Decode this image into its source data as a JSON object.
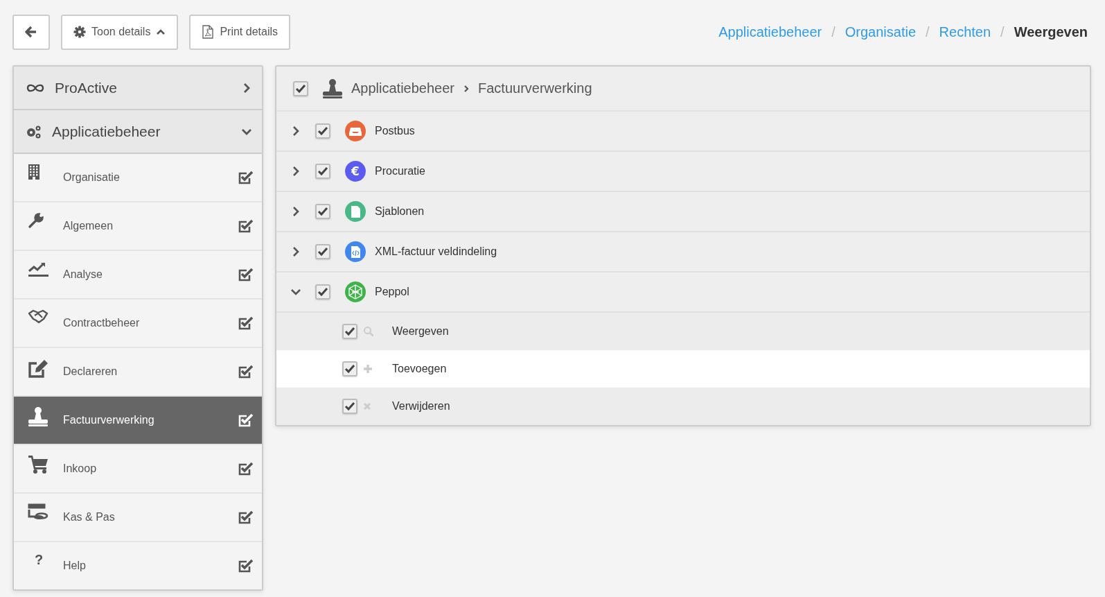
{
  "toolbar": {
    "details_button": {
      "label": "Toon details",
      "expanded": true
    },
    "print_button": {
      "label": "Print details"
    }
  },
  "breadcrumb": [
    {
      "label": "Applicatiebeheer",
      "current": false
    },
    {
      "separator": "/",
      "label": "Organisatie",
      "current": false
    },
    {
      "separator": "/",
      "label": "Rechten",
      "current": false
    },
    {
      "separator": "/",
      "label": "Weergeven",
      "current": true
    }
  ],
  "sidebar": {
    "sections": [
      {
        "label": "ProActive",
        "kind": "infinity",
        "expanded": false
      },
      {
        "label": "Applicatiebeheer",
        "kind": "gears",
        "expanded": true
      }
    ],
    "items": [
      {
        "label": "Organisatie",
        "kind": "building",
        "checked": true,
        "selected": false
      },
      {
        "label": "Algemeen",
        "kind": "wrench",
        "checked": true,
        "selected": false
      },
      {
        "label": "Analyse",
        "kind": "chart",
        "checked": true,
        "selected": false
      },
      {
        "label": "Contractbeheer",
        "kind": "handshake",
        "checked": true,
        "selected": false
      },
      {
        "label": "Declareren",
        "kind": "pencil",
        "checked": true,
        "selected": false
      },
      {
        "label": "Factuurverwerking",
        "kind": "stamp",
        "checked": true,
        "selected": true
      },
      {
        "label": "Inkoop",
        "kind": "cart",
        "checked": true,
        "selected": false
      },
      {
        "label": "Kas & Pas",
        "kind": "card",
        "checked": true,
        "selected": false
      },
      {
        "label": "Help",
        "kind": "glyph",
        "glyph": "?",
        "checked": true,
        "selected": false
      }
    ]
  },
  "panel": {
    "checked": true,
    "path": [
      "Applicatiebeheer",
      "Factuurverwerking"
    ],
    "nodes": [
      {
        "label": "Postbus",
        "kind": "inbox",
        "color": "#e8673a",
        "checked": true,
        "expanded": false
      },
      {
        "label": "Procuratie",
        "kind": "glyph",
        "glyph": "€",
        "color": "#5b5bf0",
        "checked": true,
        "expanded": false
      },
      {
        "label": "Sjablonen",
        "kind": "file",
        "color": "#48b887",
        "checked": true,
        "expanded": false
      },
      {
        "label": "XML-factuur veldindeling",
        "kind": "code",
        "color": "#3f86ee",
        "checked": true,
        "expanded": false
      },
      {
        "label": "Peppol",
        "kind": "network",
        "color": "#3fb24a",
        "checked": true,
        "expanded": true,
        "children": [
          {
            "label": "Weergeven",
            "kind": "search",
            "checked": true,
            "selected": false
          },
          {
            "label": "Toevoegen",
            "kind": "plus",
            "checked": true,
            "selected": true
          },
          {
            "label": "Verwijderen",
            "kind": "times",
            "checked": true,
            "selected": false
          }
        ]
      }
    ]
  }
}
